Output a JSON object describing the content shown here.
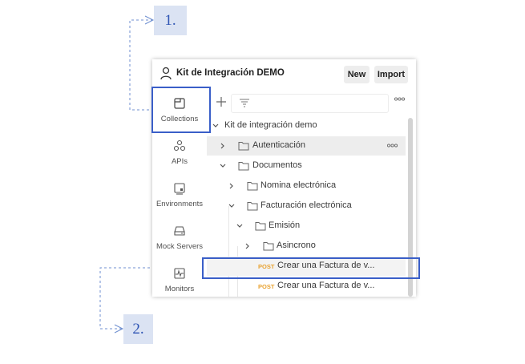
{
  "callouts": {
    "step1": "1.",
    "step2": "2."
  },
  "workspace": {
    "title": "Kit de Integración DEMO",
    "icon": "person-icon"
  },
  "header": {
    "new_label": "New",
    "import_label": "Import"
  },
  "sidebar": {
    "items": [
      {
        "label": "Collections",
        "icon": "collections-icon",
        "active": true
      },
      {
        "label": "APIs",
        "icon": "apis-icon"
      },
      {
        "label": "Environments",
        "icon": "environments-icon"
      },
      {
        "label": "Mock Servers",
        "icon": "mock-servers-icon"
      },
      {
        "label": "Monitors",
        "icon": "monitors-icon"
      }
    ]
  },
  "tree": {
    "collection": "Kit de integración demo",
    "items": [
      {
        "label": "Autenticación",
        "type": "folder",
        "expanded": false
      },
      {
        "label": "Documentos",
        "type": "folder",
        "expanded": true
      },
      {
        "label": "Nomina electrónica",
        "type": "folder",
        "expanded": false
      },
      {
        "label": "Facturación electrónica",
        "type": "folder",
        "expanded": true
      },
      {
        "label": "Emisión",
        "type": "folder",
        "expanded": true
      },
      {
        "label": "Asincrono",
        "type": "folder",
        "expanded": false
      },
      {
        "label": "Crear una Factura de v...",
        "type": "request",
        "method": "POST"
      },
      {
        "label": "Crear una Factura de v...",
        "type": "request",
        "method": "POST"
      }
    ]
  },
  "colors": {
    "highlight": "#3a5fc8",
    "post_method": "#e8a230",
    "callout_bg": "#dbe3f3"
  }
}
